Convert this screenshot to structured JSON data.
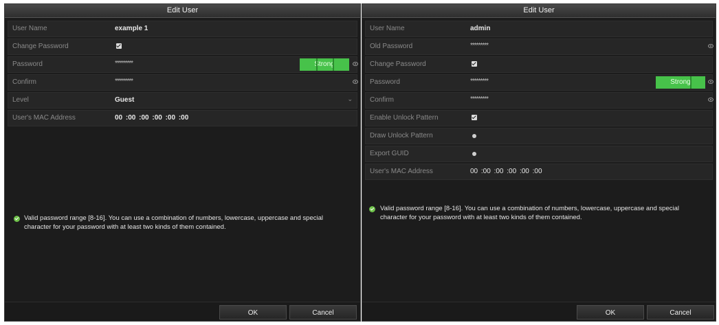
{
  "left": {
    "title": "Edit User",
    "fields": {
      "user_name_label": "User Name",
      "user_name_value": "example 1",
      "change_password_label": "Change Password",
      "password_label": "Password",
      "password_value": "*********",
      "password_strength": "Strong",
      "confirm_label": "Confirm",
      "confirm_value": "*********",
      "level_label": "Level",
      "level_value": "Guest",
      "mac_label": "User's MAC Address",
      "mac_value": "00  :00  :00  :00  :00  :00"
    },
    "hint": "Valid password range [8-16]. You can use a combination of numbers, lowercase, uppercase and special character for your password with at least two kinds of them contained.",
    "ok_label": "OK",
    "cancel_label": "Cancel"
  },
  "right": {
    "title": "Edit User",
    "fields": {
      "user_name_label": "User Name",
      "user_name_value": "admin",
      "old_password_label": "Old Password",
      "old_password_value": "*********",
      "change_password_label": "Change Password",
      "password_label": "Password",
      "password_value": "*********",
      "password_strength": "Strong",
      "confirm_label": "Confirm",
      "confirm_value": "*********",
      "enable_unlock_label": "Enable Unlock Pattern",
      "draw_unlock_label": "Draw Unlock Pattern",
      "export_guid_label": "Export GUID",
      "mac_label": "User's MAC Address",
      "mac_value": "00  :00  :00  :00  :00  :00"
    },
    "hint": "Valid password range [8-16]. You can use a combination of numbers, lowercase, uppercase and special character for your password with at least two kinds of them contained.",
    "ok_label": "OK",
    "cancel_label": "Cancel"
  },
  "icons": {
    "checkbox": "checkbox-checked-icon",
    "eye": "eye-icon",
    "chevron": "chevron-down-icon",
    "hint": "check-circle-icon",
    "dot": "dot-button-icon"
  },
  "colors": {
    "strength_green": "#47c24a",
    "hint_green": "#6fc24a",
    "panel_bg": "#1c1c1c"
  }
}
